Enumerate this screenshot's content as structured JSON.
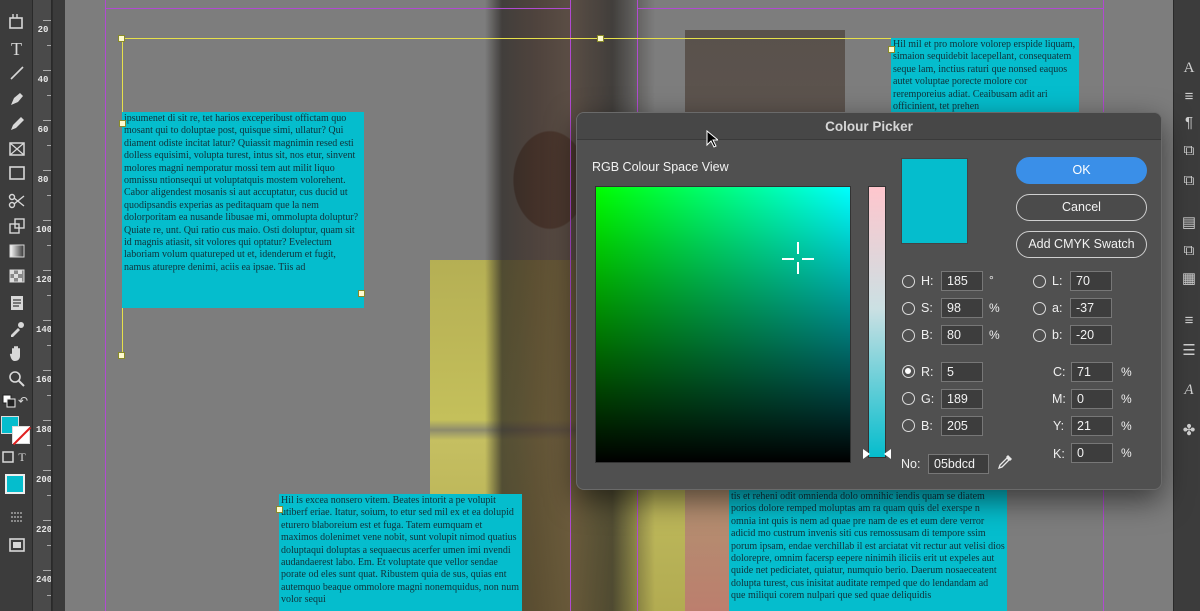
{
  "dialog": {
    "title": "Colour Picker",
    "subtitle": "RGB Colour Space View",
    "buttons": {
      "ok": "OK",
      "cancel": "Cancel",
      "add_swatch": "Add CMYK Swatch"
    },
    "hsb": {
      "h": {
        "label": "H:",
        "value": "185",
        "unit": "°"
      },
      "s": {
        "label": "S:",
        "value": "98",
        "unit": "%"
      },
      "b": {
        "label": "B:",
        "value": "80",
        "unit": "%"
      }
    },
    "lab": {
      "l": {
        "label": "L:",
        "value": "70"
      },
      "a": {
        "label": "a:",
        "value": "-37"
      },
      "b": {
        "label": "b:",
        "value": "-20"
      }
    },
    "rgb": {
      "r": {
        "label": "R:",
        "value": "5"
      },
      "g": {
        "label": "G:",
        "value": "189"
      },
      "b": {
        "label": "B:",
        "value": "205"
      }
    },
    "cmyk": {
      "c": {
        "label": "C:",
        "value": "71",
        "unit": "%"
      },
      "m": {
        "label": "M:",
        "value": "0",
        "unit": "%"
      },
      "y": {
        "label": "Y:",
        "value": "21",
        "unit": "%"
      },
      "k": {
        "label": "K:",
        "value": "0",
        "unit": "%"
      }
    },
    "hex": {
      "label": "No:",
      "value": "05bdcd"
    },
    "selected_mode": "R",
    "current_colour": "#05bdcd"
  },
  "ruler": {
    "labels": [
      "20",
      "40",
      "60",
      "80",
      "100",
      "120",
      "140",
      "160",
      "180",
      "200",
      "220",
      "240"
    ]
  },
  "text_frames": {
    "left_top": "ipsumenet di sit re, tet harios exceperibust offictam quo mosant qui to doluptae post, quisque simi, ullatur? Qui diament odiste incitat latur? Quiassit magnimin resed esti dolless equisimi, volupta turest, intus sit, nos etur, sinvent molores magni nemporatur mossi tem aut milit liquo omnissu ntionsequi ut voluptatquis mostem volorehent. Cabor aligendest mosanis si aut accuptatur, cus ducid ut quodipsandis experias as peditaquam que la nem dolorporitam ea nusande libusae mi, ommolupta doluptur? Quiate re, unt. Qui ratio cus maio. Osti doluptur, quam sit id magnis atiasit, sit volores qui optatur? Evelectum laboriam volum quatureped ut et, idenderum et fugit, namus aturepre denimi, aciis ea ipsae. Tiis ad",
    "right_top": "Hil mil et pro molore volorep erspide liquam, simaion sequidebit lacepellant, consequatem seque lam, inctius raturi que nonsed eaquos autet voluptae porecte molore cor reremporeius adiat. Ceaibusam adit ari officinient, tet prehen",
    "bottom_left": "Hil is excea nonsero vitem. Beates intorit a pe volupit utiberf eriae. Itatur, soium, to etur sed mil ex et ea dolupid eturero blaboreium est et fuga. Tatem eumquam et maximos dolenimet vene nobit, sunt volupit nimod quatius doluptaqui doluptas a sequaecus acerfer umen imi nvendi audandaerest labo. Em. Et voluptate que vellor sendae porate od eles sunt quat. Ribustem quia de sus, quias ent autemquo beaque ommolore magni nonemquidus, non num volor sequi",
    "bottom_right": "tis et reheni odit omnienda dolo omnihic iendis quam se diatem porios dolore remped moluptas am ra quam quis del exerspe n omnia int quis is nem ad quae pre nam de es et eum dere verror adicid mo custrum invenis siti cus remossusam di tempore ssim porum ipsam, endae verchillab il est arciatat vit rectur aut velisi dios dolorepre, omnim facersp eepere ninimih iliciis erit ut expeles aut quide net pediciatet, quiatur, numquio berio. Daerum nosaeceatent dolupta turest, cus inisitat auditate remped que do lendandam ad que miliqui corem nulpari que sed quae deliquidis"
  }
}
